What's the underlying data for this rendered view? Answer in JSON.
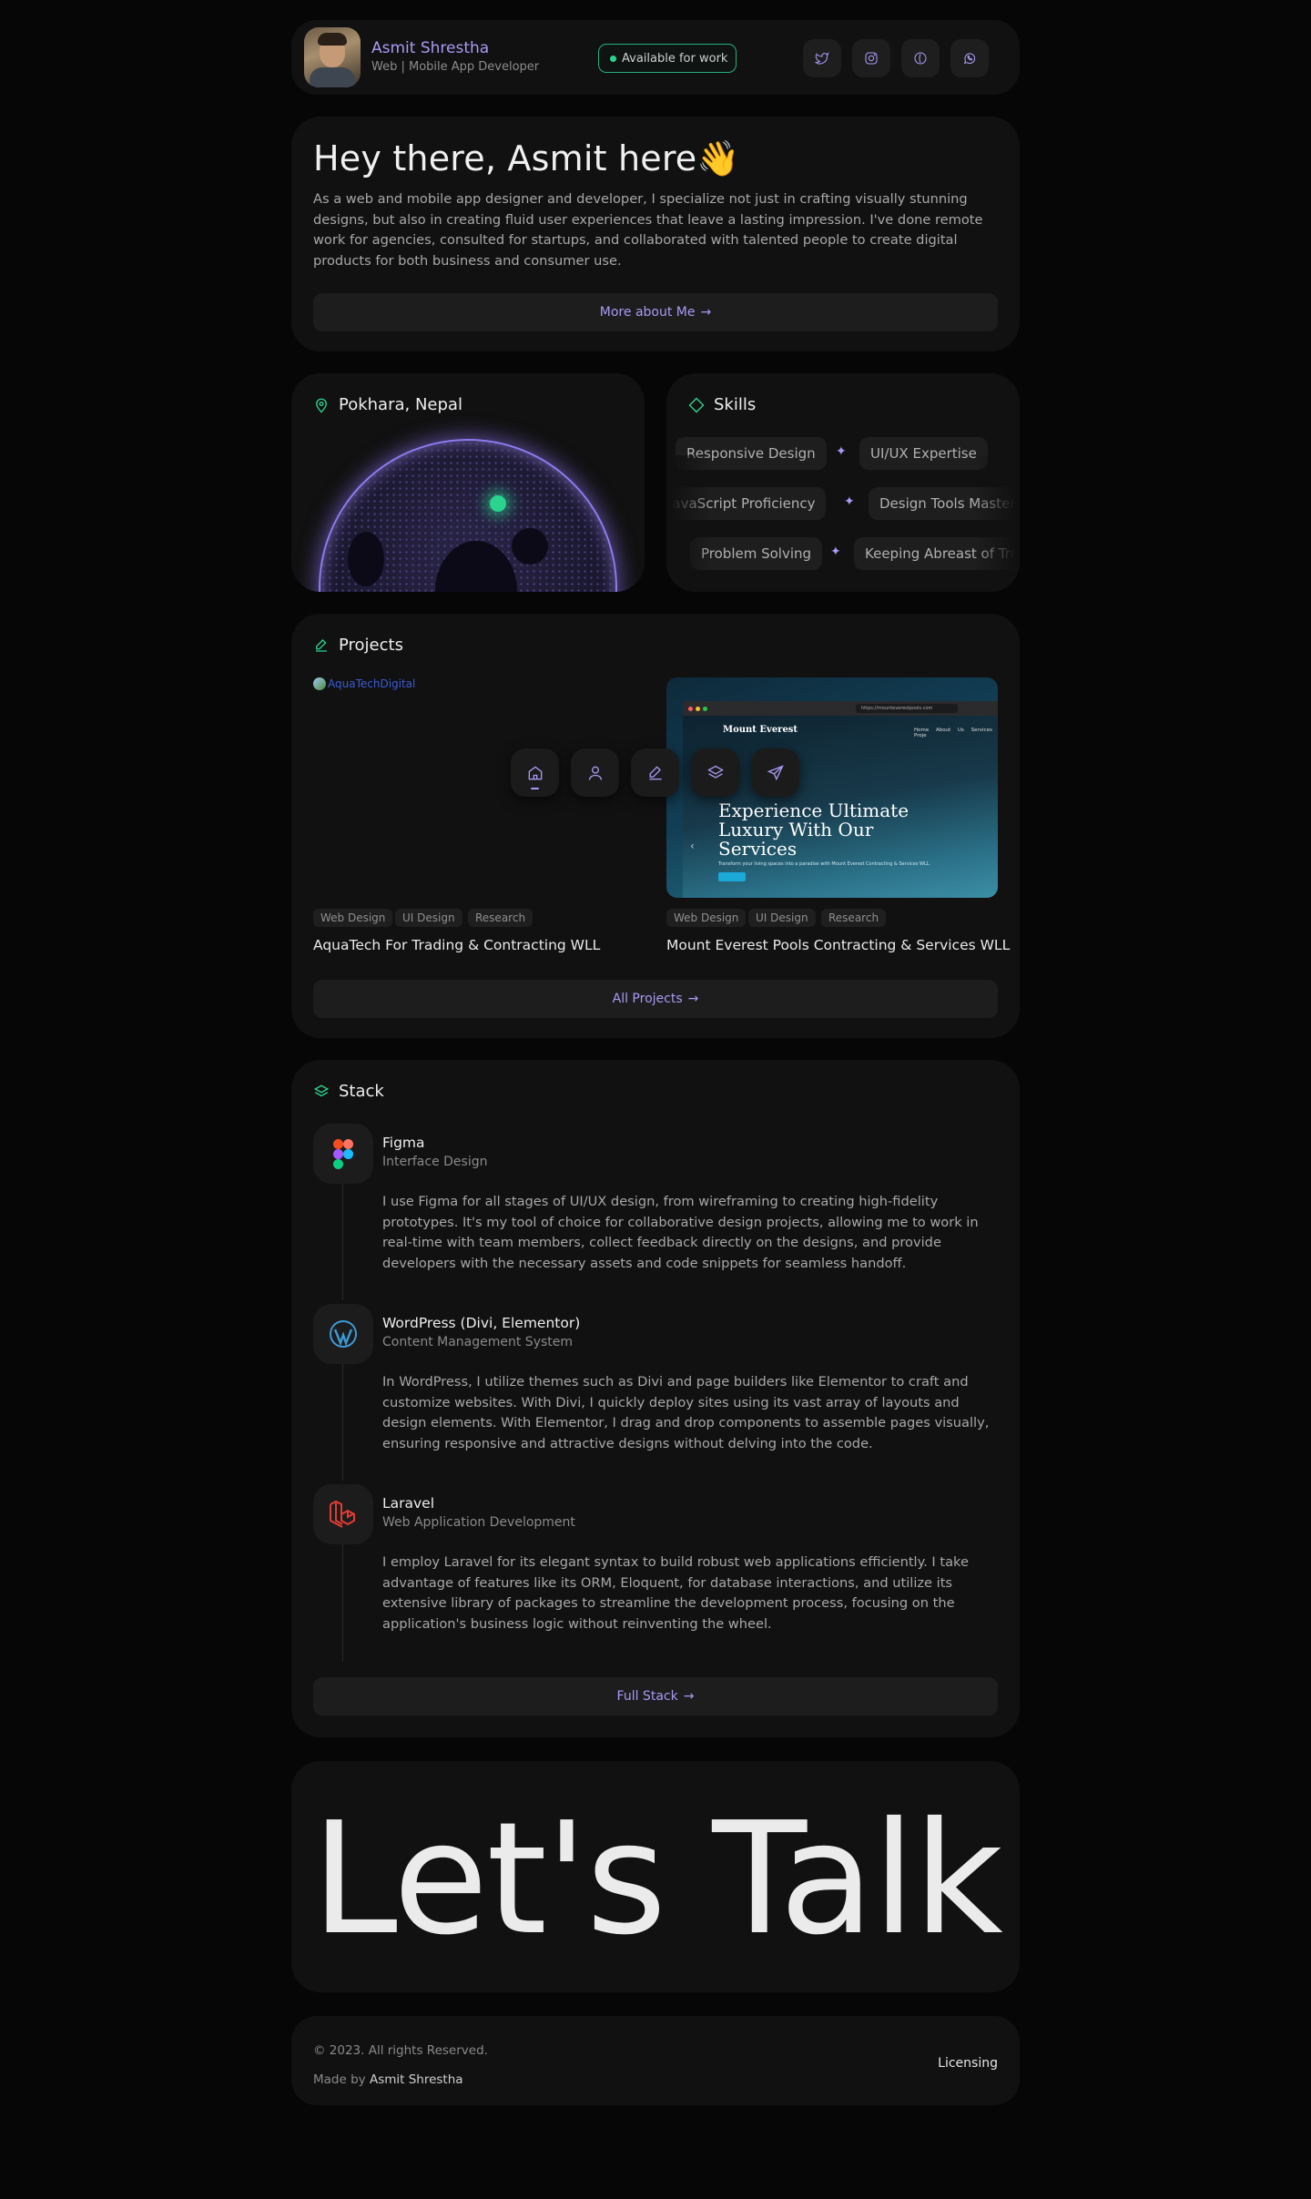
{
  "profile": {
    "name": "Asmit Shrestha",
    "role": "Web | Mobile App Developer",
    "availability": "Available for work",
    "social_icons": [
      "twitter-icon",
      "instagram-icon",
      "dribbble-icon",
      "whatsapp-icon"
    ]
  },
  "hero": {
    "heading": "Hey there, Asmit here👋",
    "bio": "As a web and mobile app designer and developer, I specialize not just in crafting visually stunning designs, but also in creating fluid user experiences that leave a lasting impression. I've done remote work for agencies, consulted for startups, and collaborated with talented people to create digital products for both business and consumer use.",
    "more_button": "More about Me"
  },
  "location": {
    "title": "Pokhara, Nepal"
  },
  "skills": {
    "title": "Skills",
    "rows": [
      [
        "Responsive Design",
        "UI/UX Expertise"
      ],
      [
        "JavaScript Proficiency",
        "Design Tools Mastery"
      ],
      [
        "Problem Solving",
        "Keeping Abreast of Trends"
      ]
    ]
  },
  "projects": {
    "title": "Projects",
    "broken_image_alt": "AquaTechDigital",
    "items": [
      {
        "title": "AquaTech For Trading & Contracting WLL",
        "tags": [
          "Web Design",
          "UI Design",
          "Research"
        ]
      },
      {
        "title": "Mount Everest Pools Contracting & Services WLL",
        "tags": [
          "Web Design",
          "UI Design",
          "Research"
        ]
      }
    ],
    "screenshot": {
      "url": "https://mounteverestpools.com",
      "brand": "Mount Everest",
      "nav": "Home About Us Services Proje",
      "headline": "Experience Ultimate Luxury With Our Services",
      "sub": "Transform your living spaces into a paradise with Mount Everest Contracting & Services WLL."
    },
    "all_button": "All Projects",
    "dock": [
      "home-icon",
      "user-icon",
      "pen-icon",
      "layers-icon",
      "send-icon"
    ]
  },
  "stack": {
    "title": "Stack",
    "items": [
      {
        "name": "Figma",
        "category": "Interface Design",
        "desc": "I use Figma for all stages of UI/UX design, from wireframing to creating high-fidelity prototypes. It's my tool of choice for collaborative design projects, allowing me to work in real-time with team members, collect feedback directly on the designs, and provide developers with the necessary assets and code snippets for seamless handoff."
      },
      {
        "name": "WordPress (Divi, Elementor)",
        "category": "Content Management System",
        "desc": "In WordPress, I utilize themes such as Divi and page builders like Elementor to craft and customize websites. With Divi, I quickly deploy sites using its vast array of layouts and design elements. With Elementor, I drag and drop components to assemble pages visually, ensuring responsive and attractive designs without delving into the code."
      },
      {
        "name": "Laravel",
        "category": "Web Application Development",
        "desc": "I employ Laravel for its elegant syntax to build robust web applications efficiently. I take advantage of features like its ORM, Eloquent, for database interactions, and utilize its extensive library of packages to streamline the development process, focusing on the application's business logic without reinventing the wheel."
      }
    ],
    "full_button": "Full Stack"
  },
  "talk": {
    "text": "Let's Talk"
  },
  "footer": {
    "copyright": "© 2023. All rights Reserved.",
    "made_prefix": "Made by",
    "made_name": "Asmit Shrestha",
    "licensing": "Licensing"
  },
  "colors": {
    "accent": "#a99af5",
    "green": "#2bd48e",
    "card": "#111111",
    "bg": "#060606"
  }
}
